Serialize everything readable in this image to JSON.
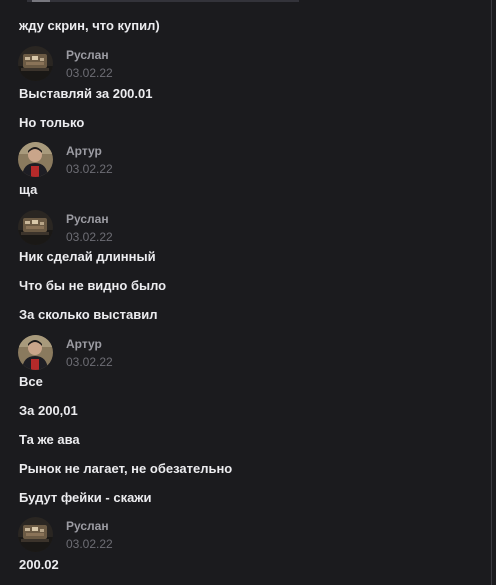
{
  "chat": {
    "messages": [
      {
        "text": "жду скрин, что купил)"
      },
      {
        "author": "Руслан",
        "date": "03.02.22",
        "avatar": "ruslan-avatar"
      },
      {
        "text": "Выставляй за 200.01"
      },
      {
        "text": "Но только"
      },
      {
        "author": "Артур",
        "date": "03.02.22",
        "avatar": "artur-avatar"
      },
      {
        "text": "ща"
      },
      {
        "author": "Руслан",
        "date": "03.02.22",
        "avatar": "ruslan-avatar"
      },
      {
        "text": "Ник сделай длинный"
      },
      {
        "text": "Что бы не видно было"
      },
      {
        "text": "За сколько выставил"
      },
      {
        "author": "Артур",
        "date": "03.02.22",
        "avatar": "artur-avatar"
      },
      {
        "text": "Все"
      },
      {
        "text": "За 200,01"
      },
      {
        "text": "Та же ава"
      },
      {
        "text": "Рынок не лагает, не обезательно"
      },
      {
        "text": "Будут фейки - скажи"
      },
      {
        "author": "Руслан",
        "date": "03.02.22",
        "avatar": "ruslan-avatar"
      },
      {
        "text": "200.02"
      }
    ]
  },
  "colors": {
    "background": "#1b1b1e",
    "message_text": "#ececef",
    "author_name": "#9c9ca3",
    "timestamp": "#6d6d74"
  }
}
